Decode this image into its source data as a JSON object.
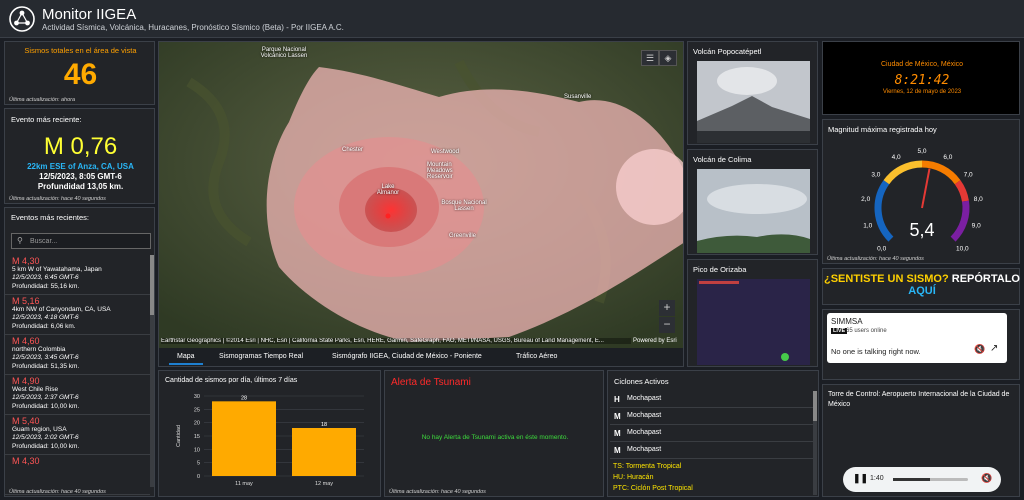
{
  "header": {
    "title": "Monitor IIGEA",
    "subtitle": "Actividad Sísmica, Volcánica, Huracanes, Pronóstico Sísmico (Beta) - Por IIGEA A.C."
  },
  "total": {
    "title": "Sismos totales en el área de vista",
    "count": "46",
    "updated": "Última actualización: ahora"
  },
  "recent": {
    "title": "Evento más reciente:",
    "magnitude": "M 0,76",
    "place": "22km ESE of Anza, CA, USA",
    "datetime": "12/5/2023, 8:05 GMT-6",
    "depth": "Profundidad 13,05 km.",
    "updated": "Última actualización: hace 40 segundos"
  },
  "events": {
    "title": "Eventos más recientes:",
    "search_placeholder": "Buscar...",
    "updated": "Última actualización: hace 40 segundos",
    "items": [
      {
        "mag": "M 4,30",
        "place": "5 km W of Yawatahama, Japan",
        "time": "12/5/2023, 6:45 GMT-6",
        "depth": "Profundidad: 55,16 km."
      },
      {
        "mag": "M 5,16",
        "place": "4km NW of Canyondam, CA, USA",
        "time": "12/5/2023, 4:18 GMT-6",
        "depth": "Profundidad: 6,06 km."
      },
      {
        "mag": "M 4,60",
        "place": "northern Colombia",
        "time": "12/5/2023, 3:45 GMT-6",
        "depth": "Profundidad: 51,35 km."
      },
      {
        "mag": "M 4,90",
        "place": "West Chile Rise",
        "time": "12/5/2023, 2:37 GMT-6",
        "depth": "Profundidad: 10,00 km."
      },
      {
        "mag": "M 5,40",
        "place": "Guam region, USA",
        "time": "12/5/2023, 2:02 GMT-6",
        "depth": "Profundidad: 10,00 km."
      },
      {
        "mag": "M 4,30",
        "place": "",
        "time": "",
        "depth": ""
      }
    ]
  },
  "map": {
    "labels": [
      "Parque Nacional Volcánico Lassen",
      "Chester",
      "Westwood",
      "Mountain Meadows Reservoir",
      "Susanville",
      "Lake Almanor",
      "Bosque Nacional Lassen",
      "Greenville"
    ],
    "attribution": "Earthstar Geographics | ©2014 Esri | NHC, Esri | California State Parks, Esri, HERE, Garmin, SafeGraph, FAO, METI/NASA, USGS, Bureau of Land Management, E...",
    "powered": "Powered by Esri",
    "zoom_in": "+",
    "zoom_out": "−"
  },
  "tabs": [
    "Mapa",
    "Sismogramas Tiempo Real",
    "Sismógrafo IIGEA, Ciudad de México - Poniente",
    "Tráfico Aéreo"
  ],
  "chart_panel": {
    "title": "Cantidad de sismos por día, últimos 7 días"
  },
  "chart_data": {
    "type": "bar",
    "categories": [
      "11 may",
      "12 may"
    ],
    "values": [
      28,
      18
    ],
    "ylabel": "Cantidad",
    "ylim": [
      0,
      30
    ],
    "yticks": [
      0,
      5,
      10,
      15,
      20,
      25,
      30
    ],
    "color": "#ffaa00"
  },
  "tsunami": {
    "title": "Alerta de Tsunami",
    "message": "No hay Alerta de Tsunami activa en éste momento.",
    "updated": "Última actualización: hace 40 segundos"
  },
  "cyclones": {
    "title": "Ciclones Activos",
    "items": [
      {
        "icon": "H",
        "name": "Mochapast"
      },
      {
        "icon": "M",
        "name": "Mochapast"
      },
      {
        "icon": "M",
        "name": "Mochapast"
      },
      {
        "icon": "M",
        "name": "Mochapast"
      }
    ],
    "legend": [
      "TS: Tormenta Tropical",
      "HU: Huracán",
      "PTC: Ciclón Post Tropical"
    ]
  },
  "volcanoes": [
    {
      "name": "Volcán Popocatépetl"
    },
    {
      "name": "Volcán de Colima"
    },
    {
      "name": "Pico de Orizaba"
    }
  ],
  "clock": {
    "city": "Ciudad de México, México",
    "time": "8:21:42",
    "date": "Viernes, 12 de mayo de 2023"
  },
  "gauge": {
    "title": "Magnitud máxima registrada hoy",
    "value": 5.4,
    "display": "5,4",
    "ticks": [
      "0,0",
      "1,0",
      "2,0",
      "3,0",
      "4,0",
      "5,0",
      "6,0",
      "7,0",
      "8,0",
      "9,0",
      "10,0"
    ],
    "updated": "Última actualización: hace 40 segundos"
  },
  "report": {
    "part1": "¿SENTISTE UN SISMO?",
    "part2": " REPÓRTALO",
    "part3": "AQUÍ"
  },
  "simmsa": {
    "title": "SIMMSA",
    "live": "LIVE",
    "users": "65 users online",
    "status": "No one is talking right now."
  },
  "tower": {
    "title": "Torre de Control: Aeropuerto Internacional de la Ciudad de México",
    "time": "1:40"
  }
}
